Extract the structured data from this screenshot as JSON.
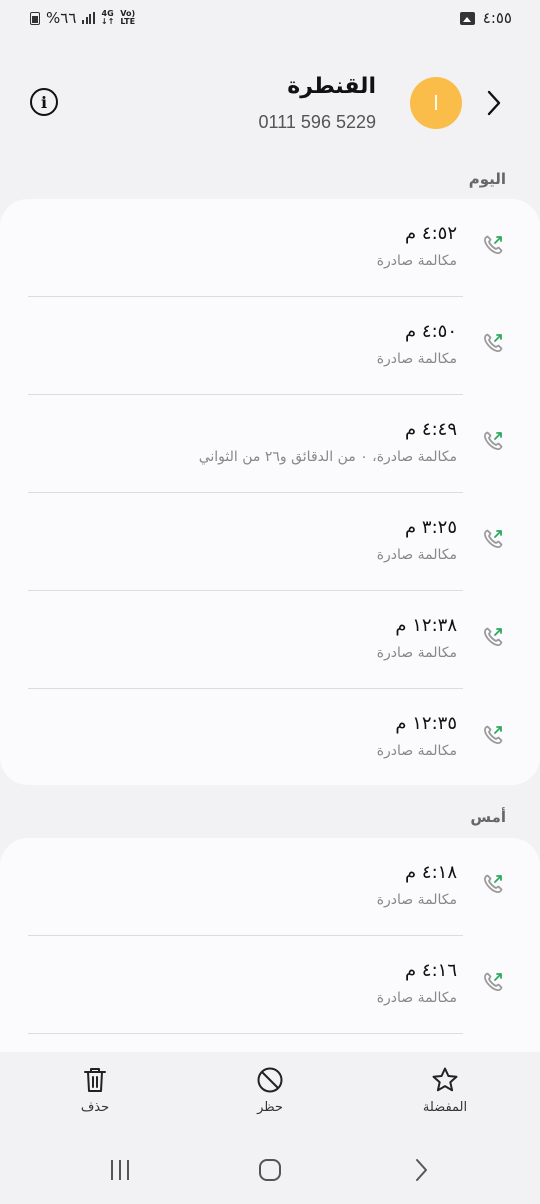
{
  "status_bar": {
    "battery_text": "%٦٦",
    "network": "4G",
    "volte_line1": "Vo)",
    "volte_line2": "LTE",
    "clock": "٤:٥٥"
  },
  "header": {
    "contact_name": "القنطرة",
    "phone_number": "0111 596 5229",
    "avatar_initial": "ا"
  },
  "sections": [
    {
      "label": "اليوم",
      "calls": [
        {
          "time": "٤:٥٢ م",
          "detail": "مكالمة صادرة"
        },
        {
          "time": "٤:٥٠ م",
          "detail": "مكالمة صادرة"
        },
        {
          "time": "٤:٤٩ م",
          "detail": "مكالمة صادرة، ٠ من الدقائق و٢٦ من الثواني"
        },
        {
          "time": "٣:٢٥ م",
          "detail": "مكالمة صادرة"
        },
        {
          "time": "١٢:٣٨ م",
          "detail": "مكالمة صادرة"
        },
        {
          "time": "١٢:٣٥ م",
          "detail": "مكالمة صادرة"
        }
      ]
    },
    {
      "label": "أمس",
      "calls": [
        {
          "time": "٤:١٨ م",
          "detail": "مكالمة صادرة"
        },
        {
          "time": "٤:١٦ م",
          "detail": "مكالمة صادرة"
        }
      ]
    }
  ],
  "actions": {
    "delete": "حذف",
    "block": "حظر",
    "favorite": "المفضلة"
  },
  "icons": {
    "call_icon": "outgoing-call-icon",
    "call_gray": "#9a9a9a",
    "arrow_green": "#2eaa5c",
    "avatar_color": "#fbbd4a"
  }
}
